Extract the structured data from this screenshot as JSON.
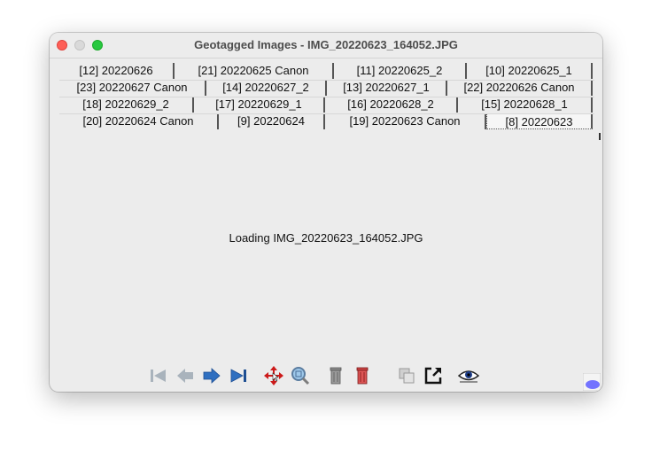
{
  "window": {
    "title": "Geotagged Images - IMG_20220623_164052.JPG"
  },
  "tabs": [
    {
      "label": "[12] 20220626"
    },
    {
      "label": "[21] 20220625 Canon"
    },
    {
      "label": "[11] 20220625_2"
    },
    {
      "label": "[10] 20220625_1"
    },
    {
      "label": "[23] 20220627 Canon"
    },
    {
      "label": "[14] 20220627_2"
    },
    {
      "label": "[13] 20220627_1"
    },
    {
      "label": "[22] 20220626 Canon"
    },
    {
      "label": "[18] 20220629_2"
    },
    {
      "label": "[17] 20220629_1"
    },
    {
      "label": "[16] 20220628_2"
    },
    {
      "label": "[15] 20220628_1"
    },
    {
      "label": "[20] 20220624 Canon"
    },
    {
      "label": "[9] 20220624"
    },
    {
      "label": "[19] 20220623 Canon"
    },
    {
      "label": "[8] 20220623"
    }
  ],
  "selected_tab": "[8] 20220623",
  "content": {
    "loading_text": "Loading IMG_20220623_164052.JPG"
  },
  "toolbar": {
    "icons": [
      "first-icon",
      "previous-icon",
      "next-icon",
      "last-icon",
      "move-icon",
      "zoom-icon",
      "trash-icon",
      "delete-red-icon",
      "copy-icon",
      "open-external-icon",
      "eye-icon"
    ]
  },
  "colors": {
    "close": "#fe5f57",
    "maximize": "#28c840",
    "minimize_inactive": "#d9d9d9",
    "window_bg": "#ececec"
  }
}
